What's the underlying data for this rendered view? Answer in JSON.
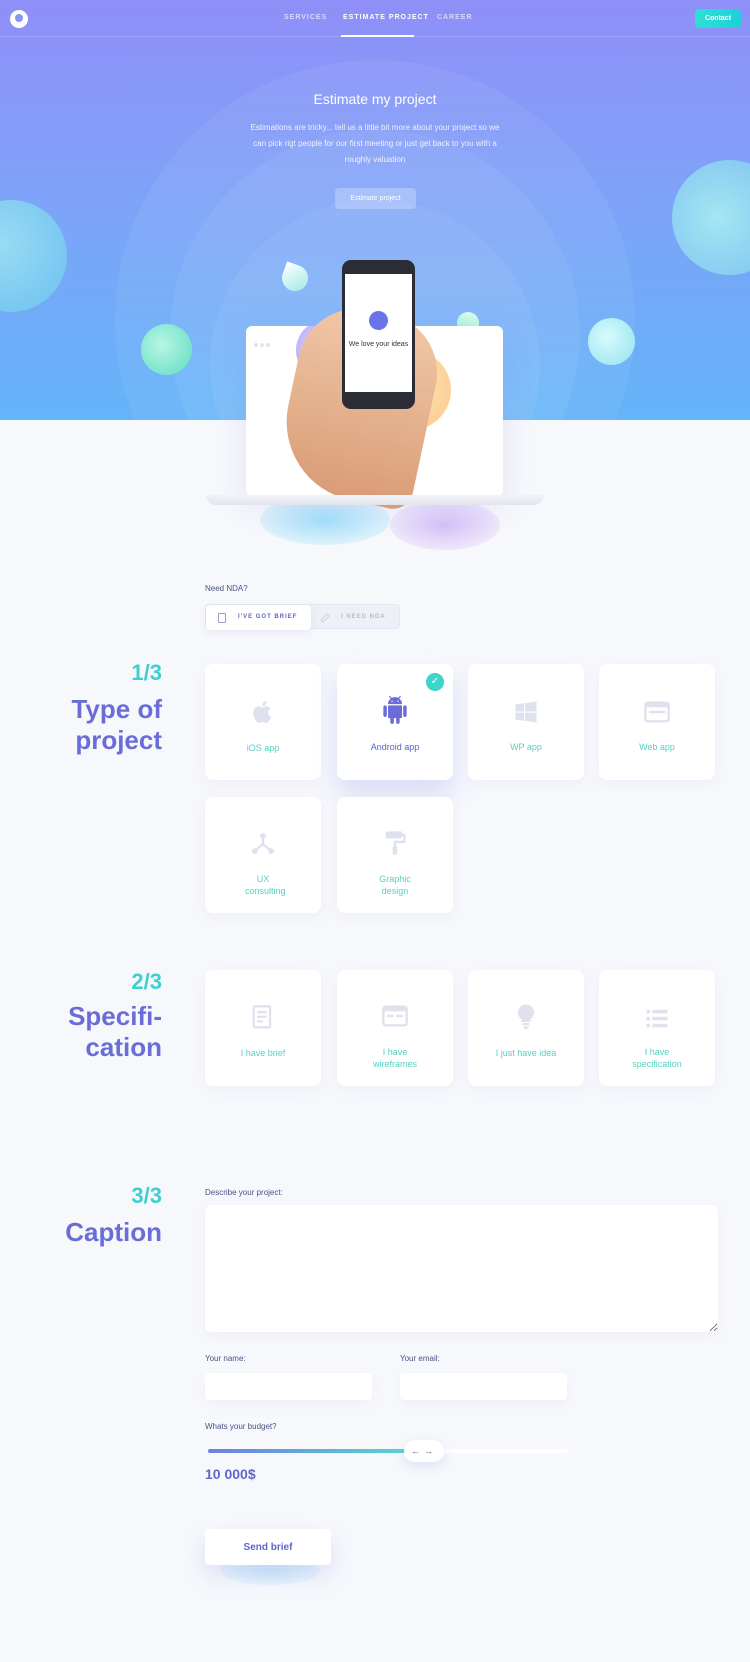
{
  "nav": {
    "items": [
      "SERVICES",
      "ESTIMATE PROJECT",
      "CAREER"
    ],
    "active_index": 1,
    "contact_label": "Contact"
  },
  "hero": {
    "title": "Estimate my project",
    "description": "Estimations are tricky... tell us a little bit more about your project so we can pick rigt people for our first meeting or just get back to you with a roughly valuation",
    "button_label": "Estimate project",
    "phone_text": "We love your ideas"
  },
  "nda": {
    "label": "Need NDA?",
    "options": [
      "I'VE GOT BRIEF",
      "I NEED NDA"
    ],
    "selected_index": 0
  },
  "step1": {
    "number": "1/3",
    "title": "Type of project",
    "cards": [
      {
        "label": "iOS app",
        "icon": "apple-icon",
        "selected": false
      },
      {
        "label": "Android app",
        "icon": "android-icon",
        "selected": true
      },
      {
        "label": "WP app",
        "icon": "windows-icon",
        "selected": false
      },
      {
        "label": "Web app",
        "icon": "browser-icon",
        "selected": false
      },
      {
        "label": "UX consulting",
        "icon": "network-icon",
        "selected": false
      },
      {
        "label": "Graphic design",
        "icon": "paint-roller-icon",
        "selected": false
      }
    ]
  },
  "step2": {
    "number": "2/3",
    "title": "Specifi- cation",
    "cards": [
      {
        "label": "I have brief",
        "icon": "document-icon"
      },
      {
        "label": "I have wireframes",
        "icon": "wireframe-icon"
      },
      {
        "label": "I just have idea",
        "icon": "lightbulb-icon"
      },
      {
        "label": "I have specification",
        "icon": "list-icon"
      }
    ]
  },
  "step3": {
    "number": "3/3",
    "title": "Caption",
    "describe_label": "Describe your project:",
    "name_label": "Your name:",
    "email_label": "Your email:",
    "budget_label": "Whats your budget?",
    "budget_value": "10 000$",
    "budget_fraction": 0.56,
    "slider_arrows": "←→",
    "send_label": "Send brief"
  },
  "colors": {
    "accent_teal": "#3dd0d0",
    "accent_purple": "#6a6dd8",
    "hero_top": "#8f8ff8",
    "hero_bottom": "#64b4f9"
  }
}
